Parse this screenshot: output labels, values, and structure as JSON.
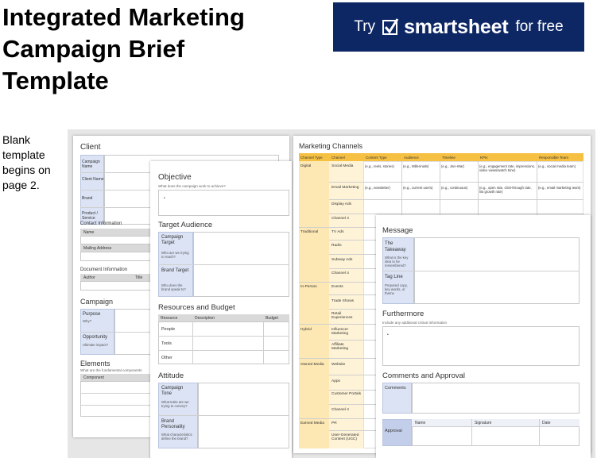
{
  "header": {
    "title_lines": [
      "Integrated Marketing",
      "Campaign Brief",
      "Template"
    ]
  },
  "ad": {
    "try": "Try",
    "brand": "smartsheet",
    "for_free": "for free",
    "bg_color": "#0d2765",
    "icon": "checkbox-icon"
  },
  "note": {
    "lines": [
      "Blank",
      "template",
      "begins on",
      "page 2."
    ]
  },
  "page1": {
    "client_title": "Client",
    "client_rows": [
      "Campaign Name",
      "Client Name",
      "Brand",
      "Product / Service"
    ],
    "contact_title": "Contact Information",
    "contact_rows": [
      "Name",
      "Mailing Address"
    ],
    "document_title": "Document Information",
    "document_cols": [
      "Author",
      "Title"
    ],
    "campaign_title": "Campaign",
    "campaign_rows": [
      {
        "label": "Purpose",
        "hint": "Why?"
      },
      {
        "label": "Opportunity",
        "hint": "Ultimate impact?"
      }
    ],
    "elements_title": "Elements",
    "elements_sub": "What are the fundamental components",
    "elements_col": "Component"
  },
  "page2": {
    "objective_title": "Objective",
    "objective_sub": "What does the campaign work to achieve?",
    "bullet": "•",
    "audience_title": "Target Audience",
    "audience_rows": [
      {
        "label": "Campaign Target",
        "hint": "Who are we trying to reach?"
      },
      {
        "label": "Brand Target",
        "hint": "Who does the brand speak to?"
      }
    ],
    "resources_title": "Resources and Budget",
    "resources_cols": [
      "Resource",
      "Description",
      "Budget"
    ],
    "resources_rows": [
      "People",
      "Tools",
      "Other"
    ],
    "attitude_title": "Attitude",
    "attitude_rows": [
      {
        "label": "Campaign Tone",
        "hint": "What traits are we trying to convey?"
      },
      {
        "label": "Brand Personality",
        "hint": "What characteristics define the brand?"
      }
    ]
  },
  "page3": {
    "title": "Marketing Channels",
    "cols": [
      "Channel Type",
      "Channel",
      "Content Type",
      "Audience",
      "Timeline",
      "KPIs",
      "Responsible Team"
    ],
    "example_social": [
      "(e.g., reels, stories)",
      "(e.g., Millennials)",
      "(e.g., Jan–Mar)",
      "(e.g., engagement rate, impressions, video views/watch time)",
      "(e.g., social media team)"
    ],
    "example_email": [
      "(e.g., newsletter)",
      "(e.g., current users)",
      "(e.g., continuous)",
      "(e.g., open rate, click-through rate, list growth rate)",
      "(e.g., email marketing team)"
    ],
    "groups": [
      {
        "type": "Digital",
        "channels": [
          "Social Media",
          "Email Marketing",
          "Display Ads",
          "Channel 4"
        ]
      },
      {
        "type": "Traditional",
        "channels": [
          "TV Ads",
          "Radio",
          "Subway Ads",
          "Channel 4"
        ]
      },
      {
        "type": "In-Person",
        "channels": [
          "Events",
          "Trade Shows",
          "Retail Experiences"
        ]
      },
      {
        "type": "Hybrid",
        "channels": [
          "Influencer Marketing",
          "Affiliate Marketing"
        ]
      },
      {
        "type": "Owned Media",
        "channels": [
          "Website",
          "Apps",
          "Customer Portals",
          "Channel 4"
        ]
      },
      {
        "type": "Earned Media",
        "channels": [
          "PR",
          "User-Generated Content (UGC)"
        ]
      }
    ]
  },
  "page4": {
    "message_title": "Message",
    "message_rows": [
      {
        "label": "The Takeaway",
        "hint": "What is the key idea to be remembered?"
      },
      {
        "label": "Tag Line",
        "hint": "Prepared copy, key words, or theme"
      }
    ],
    "further_title": "Furthermore",
    "further_sub": "Include any additional critical information",
    "bullet": "•",
    "comments_title": "Comments and Approval",
    "comments_label": "Comments",
    "approval_label": "Approval",
    "approval_cols": [
      "Name",
      "Signature",
      "Date"
    ]
  }
}
